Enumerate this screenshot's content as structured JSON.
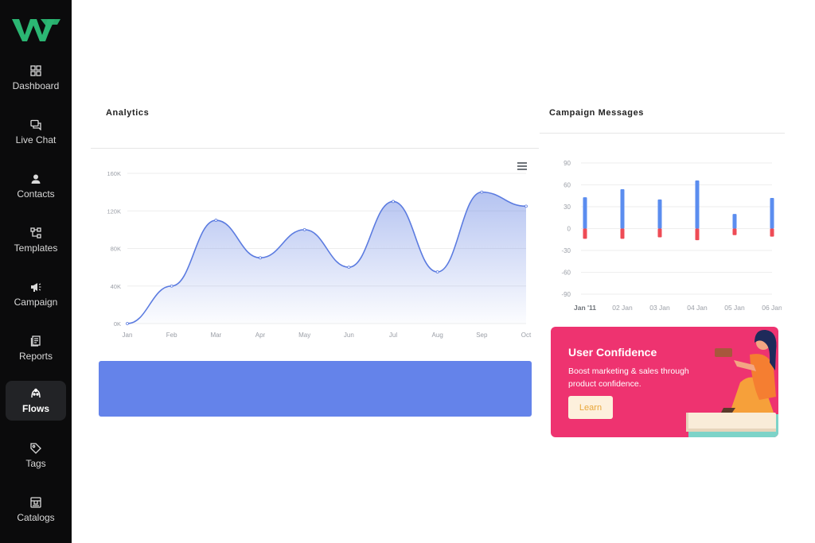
{
  "brand": {
    "logo_text": "WT",
    "logo_color": "#2bb673"
  },
  "sidebar": {
    "items": [
      {
        "label": "Dashboard",
        "icon": "dashboard-grid-icon"
      },
      {
        "label": "Live Chat",
        "icon": "chat-bubbles-icon"
      },
      {
        "label": "Contacts",
        "icon": "person-icon"
      },
      {
        "label": "Templates",
        "icon": "templates-icon"
      },
      {
        "label": "Campaign",
        "icon": "megaphone-icon"
      },
      {
        "label": "Reports",
        "icon": "reports-document-icon"
      },
      {
        "label": "Flows",
        "icon": "flows-icon",
        "active": true
      },
      {
        "label": "Tags",
        "icon": "tag-icon"
      },
      {
        "label": "Catalogs",
        "icon": "catalog-store-icon"
      }
    ]
  },
  "analytics": {
    "title": "Analytics",
    "menu_icon": "hamburger-menu-icon"
  },
  "campaign": {
    "title": "Campaign Messages"
  },
  "promo": {
    "title": "User Confidence",
    "text": "Boost marketing & sales through product confidence.",
    "button_label": "Learn",
    "background": "#ee3370"
  },
  "chart_data": [
    {
      "type": "area",
      "categories": [
        "Jan",
        "Feb",
        "Mar",
        "Apr",
        "May",
        "Jun",
        "Jul",
        "Aug",
        "Sep",
        "Oct"
      ],
      "y_ticks": [
        "0K",
        "40K",
        "80K",
        "120K",
        "160K"
      ],
      "ylim": [
        0,
        160000
      ],
      "series": [
        {
          "values": [
            0,
            40000,
            110000,
            70000,
            100000,
            60000,
            130000,
            55000,
            140000,
            125000
          ]
        }
      ],
      "color": "#5b7be0",
      "grid": true
    },
    {
      "type": "bar",
      "categories": [
        "Jan '11",
        "02 Jan",
        "03 Jan",
        "04 Jan",
        "05 Jan",
        "06 Jan"
      ],
      "y_ticks": [
        "90",
        "60",
        "30",
        "0",
        "-30",
        "-60",
        "-90"
      ],
      "ylim": [
        -90,
        90
      ],
      "series": [
        {
          "values": [
            43,
            54,
            40,
            66,
            20,
            42
          ],
          "color": "#5b8def"
        },
        {
          "values": [
            -14,
            -14,
            -12,
            -16,
            -9,
            -11
          ],
          "color": "#ee4b55"
        }
      ],
      "grid": true
    }
  ]
}
